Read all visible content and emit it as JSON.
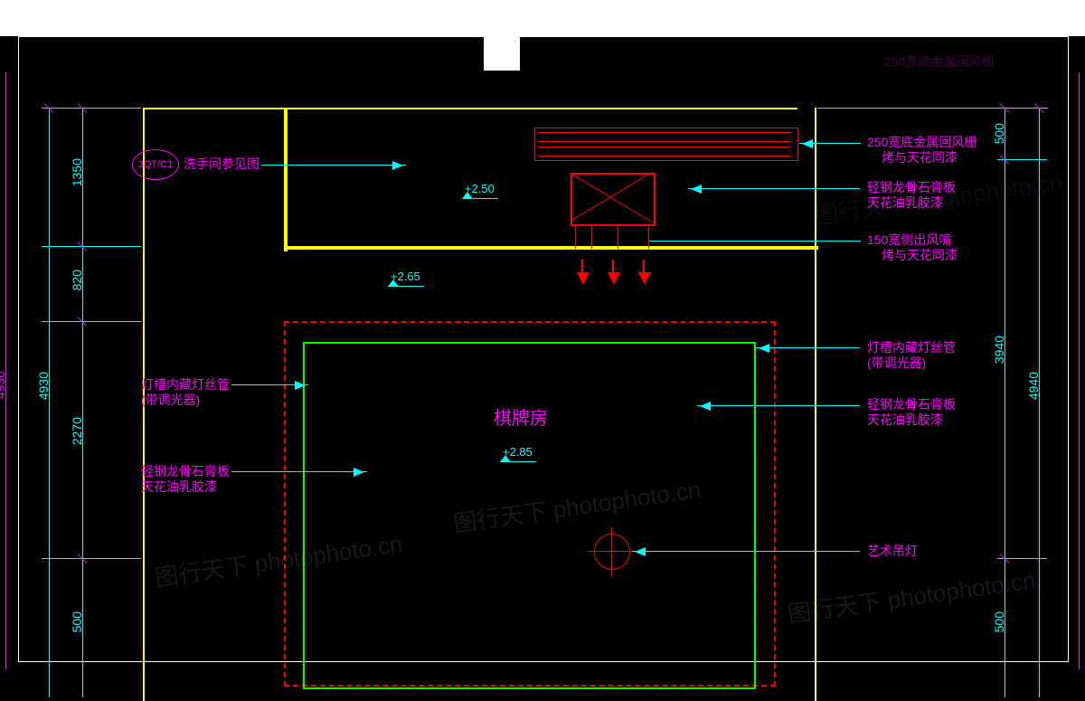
{
  "room_label": "棋牌房",
  "reference_bubble": "3QT/C1",
  "elevations": {
    "e1": "+2.50",
    "e2": "+2.65",
    "e3": "+2.85"
  },
  "annotations": {
    "left": {
      "ref": "洗手间参见图",
      "cove1": "灯槽内藏灯丝管",
      "cove1b": "(带调光器)",
      "gyp1": "轻钢龙骨石膏板",
      "gyp1b": "天花油乳胶漆"
    },
    "right": {
      "return": "250宽底金属回风栅",
      "return_b": "烤与天花同漆",
      "gyp2": "轻钢龙骨石膏板",
      "gyp2b": "天花油乳胶漆",
      "supply": "150宽侧出风嘴",
      "supply_b": "烤与天花同漆",
      "cove2": "灯槽内藏灯丝管",
      "cove2b": "(带调光器)",
      "gyp3": "轻钢龙骨石膏板",
      "gyp3b": "天花油乳胶漆",
      "pendant": "艺术吊灯"
    }
  },
  "dimensions": {
    "left_inner": [
      "1350",
      "820",
      "2270",
      "500"
    ],
    "left_overall": "4930",
    "right_inner": [
      "500",
      "3940",
      "500"
    ],
    "right_overall": "4940"
  },
  "watermark": "图行天下 photophoto.cn"
}
